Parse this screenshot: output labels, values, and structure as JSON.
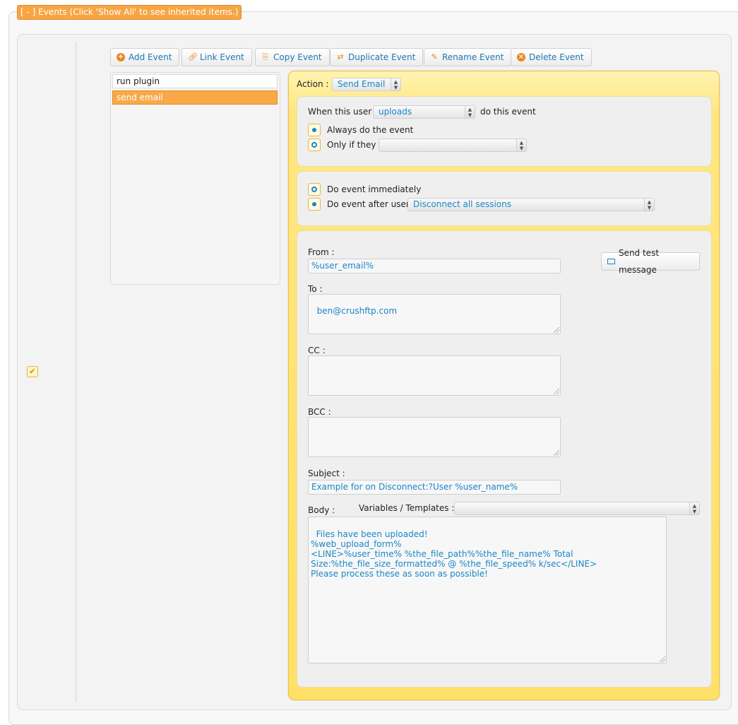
{
  "header": {
    "legend": "[ - ] Events (Click 'Show All' to see inherited items.)"
  },
  "enabled_checkbox": {
    "checked": true,
    "glyph": "✔"
  },
  "toolbar": {
    "add": "Add Event",
    "link": "Link Event",
    "copy": "Copy Event",
    "duplicate": "Duplicate Event",
    "rename": "Rename Event",
    "delete": "Delete Event"
  },
  "events": [
    "run plugin",
    "send email"
  ],
  "selected_event": "send email",
  "action": {
    "label": "Action :",
    "value": "Send Email"
  },
  "when": {
    "prefix": "When this user",
    "trigger_value": "uploads",
    "suffix": "do this event",
    "always_label": "Always do the event",
    "only_if_label": "Only if they",
    "only_if_value": "",
    "selected": "always"
  },
  "timing": {
    "immediately_label": "Do event immediately",
    "after_label": "Do event after user",
    "after_value": "Disconnect all sessions",
    "selected": "after"
  },
  "email": {
    "from_label": "From :",
    "from_value": "%user_email%",
    "test_button": "Send test message",
    "to_label": "To :",
    "to_value": "ben@crushftp.com",
    "cc_label": "CC :",
    "cc_value": "",
    "bcc_label": "BCC :",
    "bcc_value": "",
    "subject_label": "Subject :",
    "subject_value": "Example for on Disconnect:?User %user_name%",
    "body_label": "Body :",
    "variables_label": "Variables / Templates :",
    "variables_value": "",
    "body_value": "Files have been uploaded!\n%web_upload_form%\n<LINE>%user_time% %the_file_path%%the_file_name% Total Size:%the_file_size_formatted% @ %the_file_speed% k/sec</LINE>\nPlease process these as soon as possible!"
  },
  "colors": {
    "accent": "#f9a948",
    "link": "#1a86c7",
    "panel": "#ffe067"
  }
}
